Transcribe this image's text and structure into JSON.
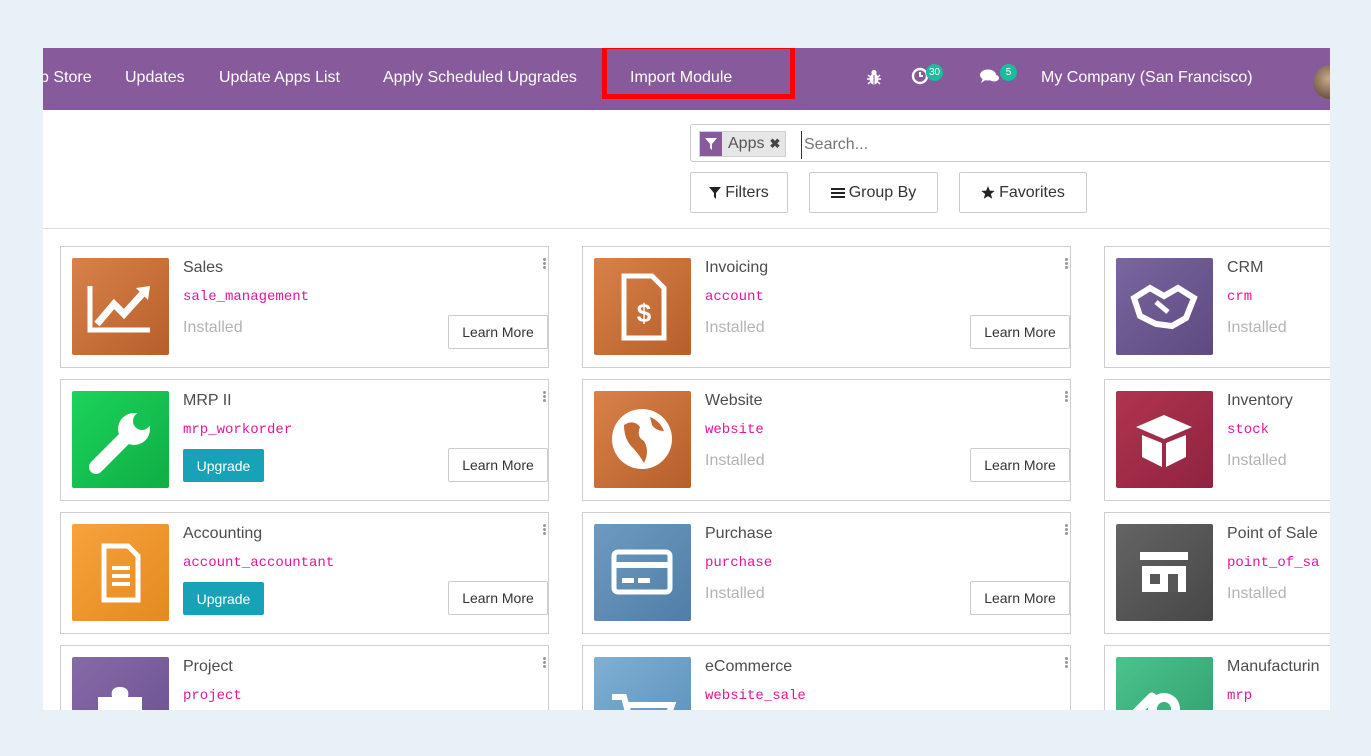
{
  "topbar": {
    "items": [
      "p Store",
      "Updates",
      "Update Apps List",
      "Apply Scheduled Upgrades",
      "Import Module"
    ],
    "activity_count": "30",
    "message_count": "5",
    "company": "My Company (San Francisco)"
  },
  "search": {
    "facet": "Apps",
    "placeholder": "Search..."
  },
  "buttons": {
    "filters": "Filters",
    "group_by": "Group By",
    "favorites": "Favorites"
  },
  "apps": [
    {
      "name": "Sales",
      "technical": "sale_management",
      "status": "Installed",
      "action": "Learn More",
      "color": "#d0743c"
    },
    {
      "name": "Invoicing",
      "technical": "account",
      "status": "Installed",
      "action": "Learn More",
      "color": "#d0743c"
    },
    {
      "name": "CRM",
      "technical": "crm",
      "status": "Installed",
      "action": "Learn More",
      "color": "#6f5b91"
    },
    {
      "name": "MRP II",
      "technical": "mrp_workorder",
      "status": "Upgrade",
      "action": "Learn More",
      "color": "#15c251"
    },
    {
      "name": "Website",
      "technical": "website",
      "status": "Installed",
      "action": "Learn More",
      "color": "#d0743c"
    },
    {
      "name": "Inventory",
      "technical": "stock",
      "status": "Installed",
      "action": "Learn More",
      "color": "#a32a48"
    },
    {
      "name": "Accounting",
      "technical": "account_accountant",
      "status": "Upgrade",
      "action": "Learn More",
      "color": "#f59a31"
    },
    {
      "name": "Purchase",
      "technical": "purchase",
      "status": "Installed",
      "action": "Learn More",
      "color": "#5e8cb0"
    },
    {
      "name": "Point of Sale",
      "technical": "point_of_sa",
      "status": "Installed",
      "action": "Learn More",
      "color": "#575757"
    },
    {
      "name": "Project",
      "technical": "project",
      "status": "",
      "action": "",
      "color": "#7a5e9c"
    },
    {
      "name": "eCommerce",
      "technical": "website_sale",
      "status": "",
      "action": "",
      "color": "#6c9fc7"
    },
    {
      "name": "Manufacturin",
      "technical": "mrp",
      "status": "",
      "action": "",
      "color": "#3bb37d"
    }
  ]
}
